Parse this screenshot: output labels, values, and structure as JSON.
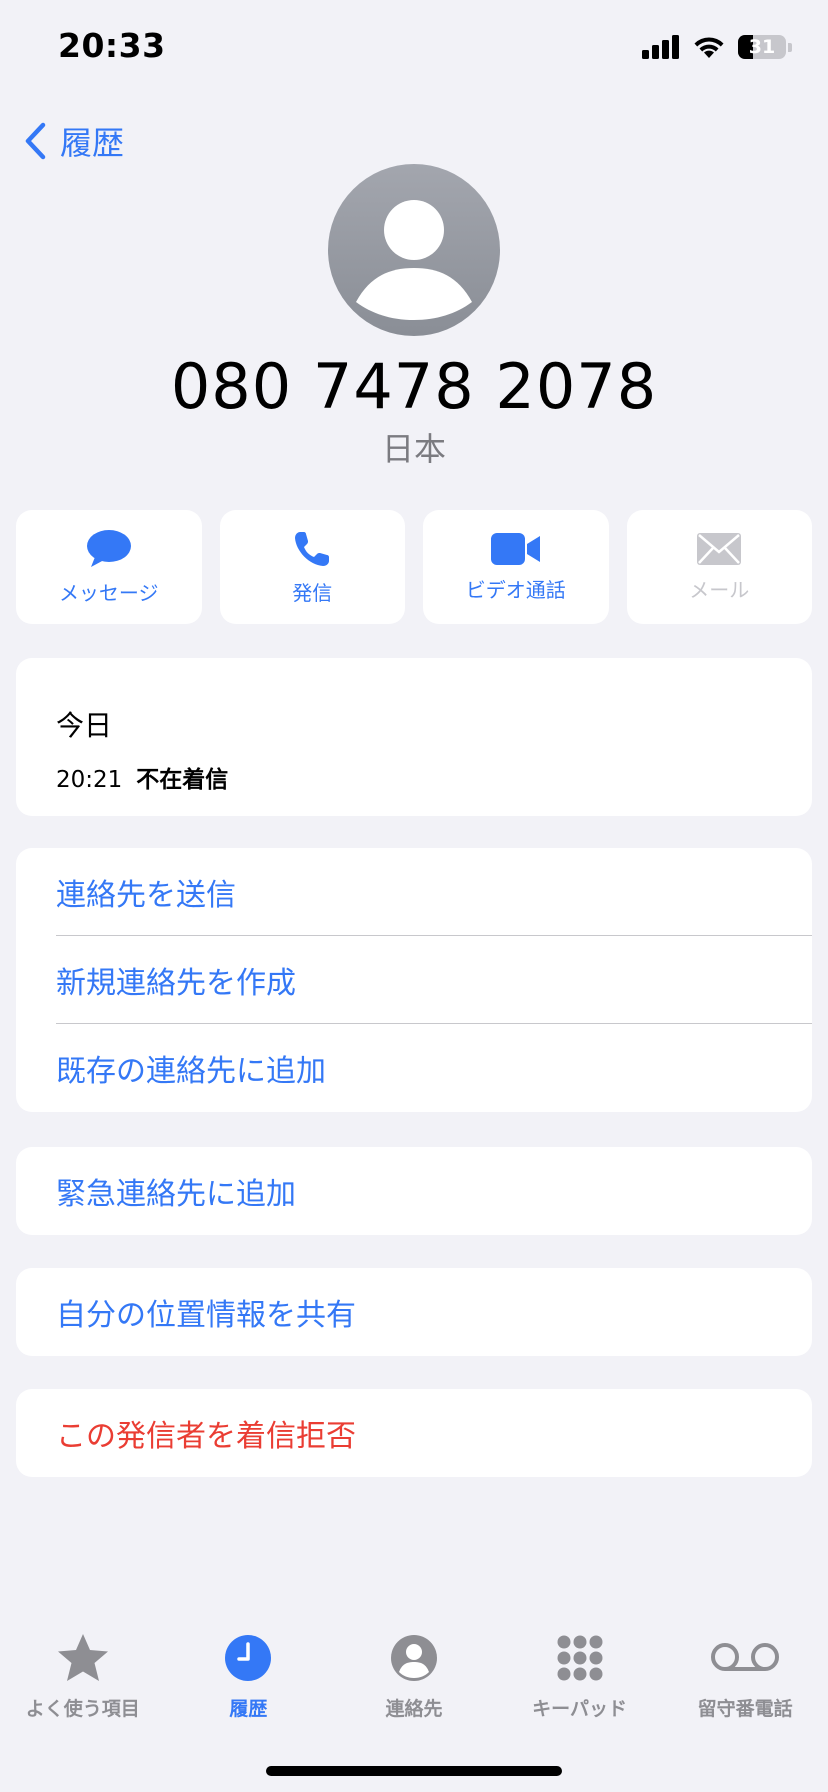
{
  "status_bar": {
    "time": "20:33",
    "battery_percent": "31",
    "battery_level": 0.31
  },
  "nav": {
    "back_label": "履歴"
  },
  "header": {
    "phone_number": "080 7478 2078",
    "country": "日本"
  },
  "actions": [
    {
      "label": "メッセージ",
      "icon": "message-bubble-icon",
      "enabled": true
    },
    {
      "label": "発信",
      "icon": "phone-icon",
      "enabled": true
    },
    {
      "label": "ビデオ通話",
      "icon": "video-camera-icon",
      "enabled": true
    },
    {
      "label": "メール",
      "icon": "envelope-icon",
      "enabled": false
    }
  ],
  "recents": {
    "day": "今日",
    "time": "20:21",
    "type": "不在着信"
  },
  "contact_actions": [
    "連絡先を送信",
    "新規連絡先を作成",
    "既存の連絡先に追加"
  ],
  "emergency": {
    "label": "緊急連絡先に追加"
  },
  "share_location": {
    "label": "自分の位置情報を共有"
  },
  "block": {
    "label": "この発信者を着信拒否"
  },
  "tabs": [
    {
      "label": "よく使う項目",
      "icon": "star-icon",
      "active": false
    },
    {
      "label": "履歴",
      "icon": "clock-icon",
      "active": true
    },
    {
      "label": "連絡先",
      "icon": "person-circle-icon",
      "active": false
    },
    {
      "label": "キーパッド",
      "icon": "keypad-icon",
      "active": false
    },
    {
      "label": "留守番電話",
      "icon": "voicemail-icon",
      "active": false
    }
  ],
  "colors": {
    "accent": "#3478f6",
    "danger": "#ea3d33",
    "background": "#f2f2f7",
    "inactive": "#8e8e93"
  }
}
